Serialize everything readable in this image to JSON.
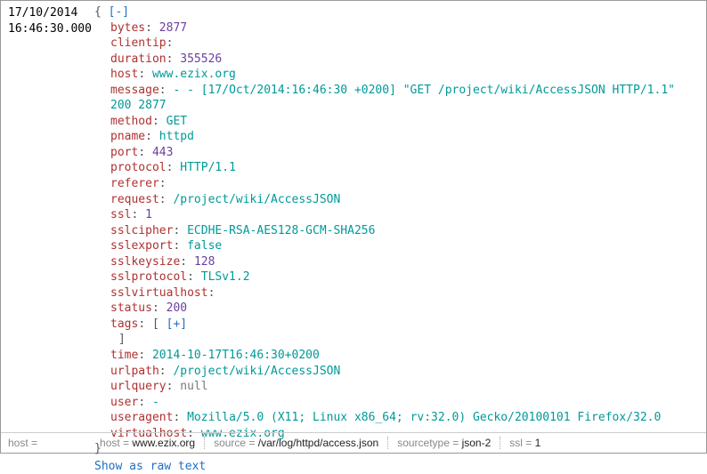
{
  "timestamp": {
    "date": "17/10/2014",
    "time": "16:46:30.000"
  },
  "expand_open": "[-]",
  "expand_plus": "[+]",
  "fields": {
    "bytes_k": "bytes",
    "bytes_v": "2877",
    "clientip_k": "clientip",
    "duration_k": "duration",
    "duration_v": "355526",
    "host_k": "host",
    "host_v": "www.ezix.org",
    "message_k": "message",
    "message_v": "          - - [17/Oct/2014:16:46:30 +0200] \"GET /project/wiki/AccessJSON HTTP/1.1\" 200 2877",
    "method_k": "method",
    "method_v": "GET",
    "pname_k": "pname",
    "pname_v": "httpd",
    "port_k": "port",
    "port_v": "443",
    "protocol_k": "protocol",
    "protocol_v": "HTTP/1.1",
    "referer_k": "referer",
    "request_k": "request",
    "request_v": "/project/wiki/AccessJSON",
    "ssl_k": "ssl",
    "ssl_v": "1",
    "sslcipher_k": "sslcipher",
    "sslcipher_v": "ECDHE-RSA-AES128-GCM-SHA256",
    "sslexport_k": "sslexport",
    "sslexport_v": "false",
    "sslkeysize_k": "sslkeysize",
    "sslkeysize_v": "128",
    "sslprotocol_k": "sslprotocol",
    "sslprotocol_v": "TLSv1.2",
    "sslvirtualhost_k": "sslvirtualhost",
    "status_k": "status",
    "status_v": "200",
    "tags_k": "tags",
    "time_k": "time",
    "time_v": "2014-10-17T16:46:30+0200",
    "urlpath_k": "urlpath",
    "urlpath_v": "/project/wiki/AccessJSON",
    "urlquery_k": "urlquery",
    "urlquery_v": "null",
    "user_k": "user",
    "user_v": "-",
    "useragent_k": "useragent",
    "useragent_v": "Mozilla/5.0 (X11; Linux x86_64; rv:32.0) Gecko/20100101 Firefox/32.0",
    "virtualhost_k": "virtualhost",
    "virtualhost_v": "www.ezix.org"
  },
  "raw_link": "Show as raw text",
  "footer": {
    "host_k": "host = ",
    "host2_k": "host = ",
    "host2_v": "www.ezix.org",
    "source_k": "source = ",
    "source_v": "/var/log/httpd/access.json",
    "sourcetype_k": "sourcetype = ",
    "sourcetype_v": "json-2",
    "ssl_k": "ssl = ",
    "ssl_v": "1"
  }
}
